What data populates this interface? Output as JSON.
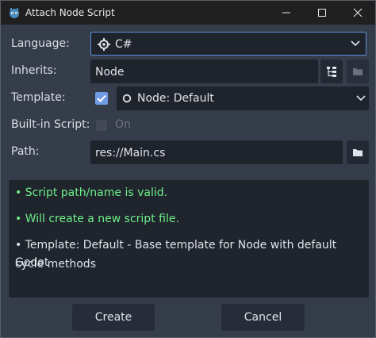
{
  "window": {
    "title": "Attach Node Script",
    "icon": "godot-icon",
    "controls": [
      "minimize-icon",
      "maximize-icon",
      "close-icon"
    ]
  },
  "form": {
    "language_label": "Language:",
    "language_value": "C#",
    "inherits_label": "Inherits:",
    "inherits_value": "Node",
    "template_label": "Template:",
    "template_checked": true,
    "template_value": "Node: Default",
    "builtin_label": "Built-in Script:",
    "builtin_checked": false,
    "builtin_state": "On",
    "path_label": "Path:",
    "path_value": "res://Main.cs"
  },
  "messages": {
    "valid": "•  Script path/name is valid.",
    "create": "•  Will create a new script file.",
    "template_line1": "•  Template: Default - Base template for Node with default Godot",
    "template_line2": "cycle methods"
  },
  "actions": {
    "create_label": "Create",
    "cancel_label": "Cancel"
  },
  "colors": {
    "accent": "#5e8ddf",
    "success": "#6cf08a",
    "background": "#363d4a"
  }
}
